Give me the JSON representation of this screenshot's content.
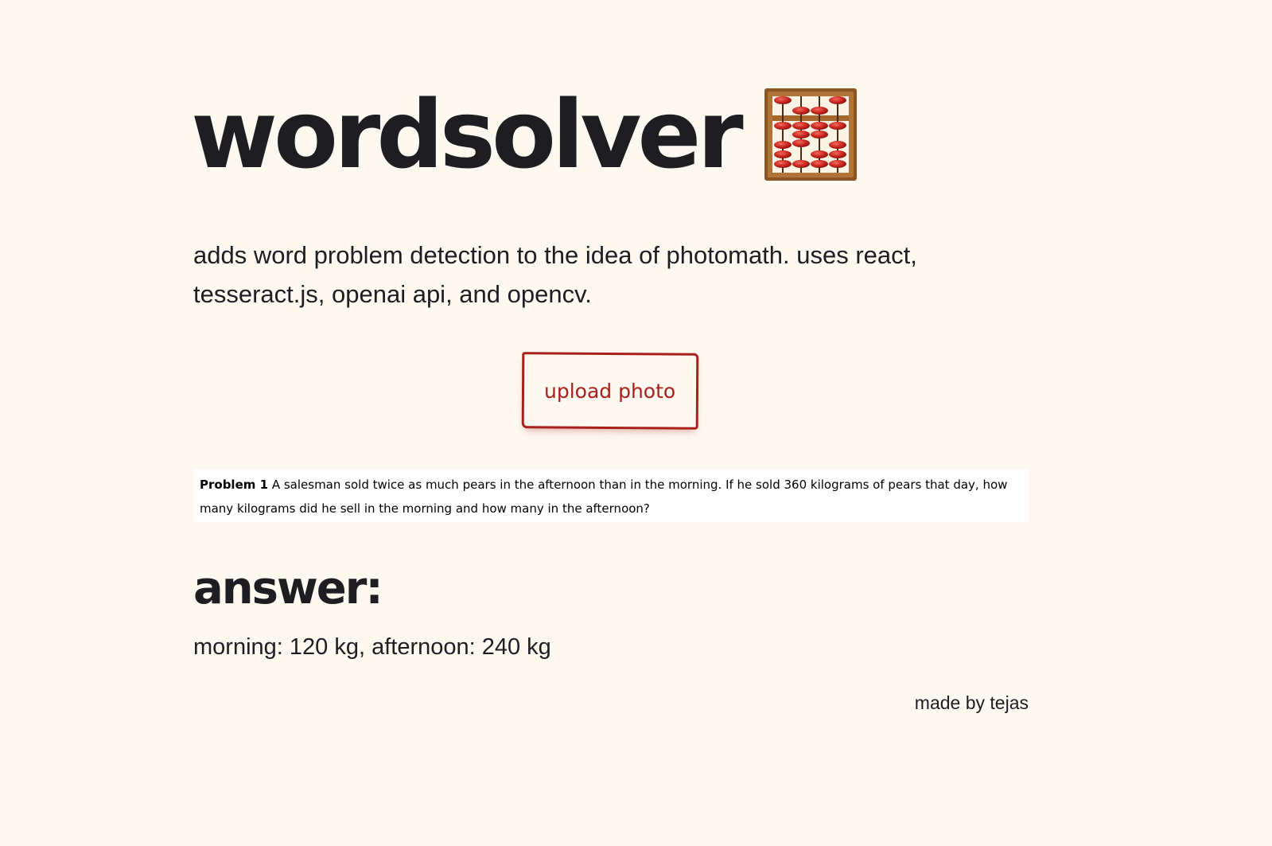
{
  "header": {
    "title": "wordsolver",
    "icon": "abacus-icon"
  },
  "description": "adds word problem detection to the idea of photomath. uses react, tesseract.js, openai api, and opencv.",
  "upload": {
    "label": "upload photo"
  },
  "problem": {
    "label": "Problem 1",
    "text": "A salesman sold twice as much pears in the afternoon than in the morning. If he sold 360 kilograms of pears that day, how many kilograms did he sell in the morning and how many in the afternoon?"
  },
  "answer": {
    "heading": "answer:",
    "text": "morning: 120 kg, afternoon: 240 kg"
  },
  "footer": {
    "credit": "made by tejas"
  },
  "colors": {
    "background": "#fdf8f0",
    "text": "#1e1d21",
    "accent": "#a91f1b"
  }
}
